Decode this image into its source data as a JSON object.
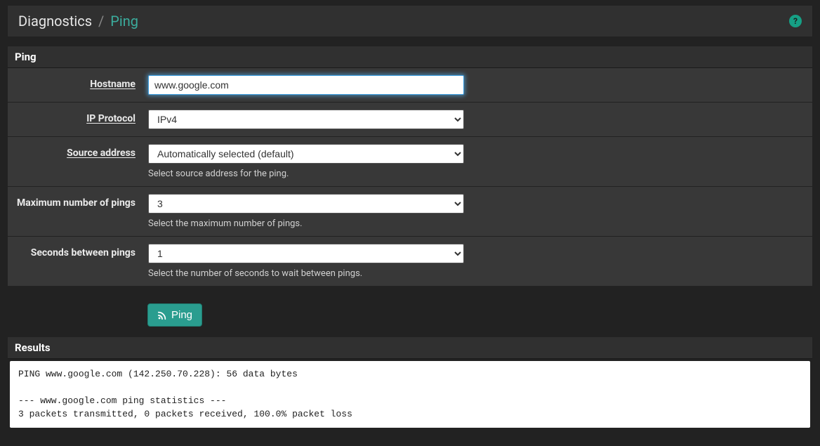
{
  "page": {
    "breadcrumb_root": "Diagnostics",
    "breadcrumb_sep": "/",
    "breadcrumb_current": "Ping",
    "help_icon_glyph": "?"
  },
  "panel_ping": {
    "title": "Ping",
    "hostname": {
      "label": "Hostname",
      "value": "www.google.com"
    },
    "ip_protocol": {
      "label": "IP Protocol",
      "value": "IPv4"
    },
    "source_address": {
      "label": "Source address",
      "value": "Automatically selected (default)",
      "help": "Select source address for the ping."
    },
    "max_pings": {
      "label": "Maximum number of pings",
      "value": "3",
      "help": "Select the maximum number of pings."
    },
    "seconds_between": {
      "label": "Seconds between pings",
      "value": "1",
      "help": "Select the number of seconds to wait between pings."
    },
    "submit_label": "Ping"
  },
  "panel_results": {
    "title": "Results",
    "output": "PING www.google.com (142.250.70.228): 56 data bytes\n\n--- www.google.com ping statistics ---\n3 packets transmitted, 0 packets received, 100.0% packet loss"
  }
}
